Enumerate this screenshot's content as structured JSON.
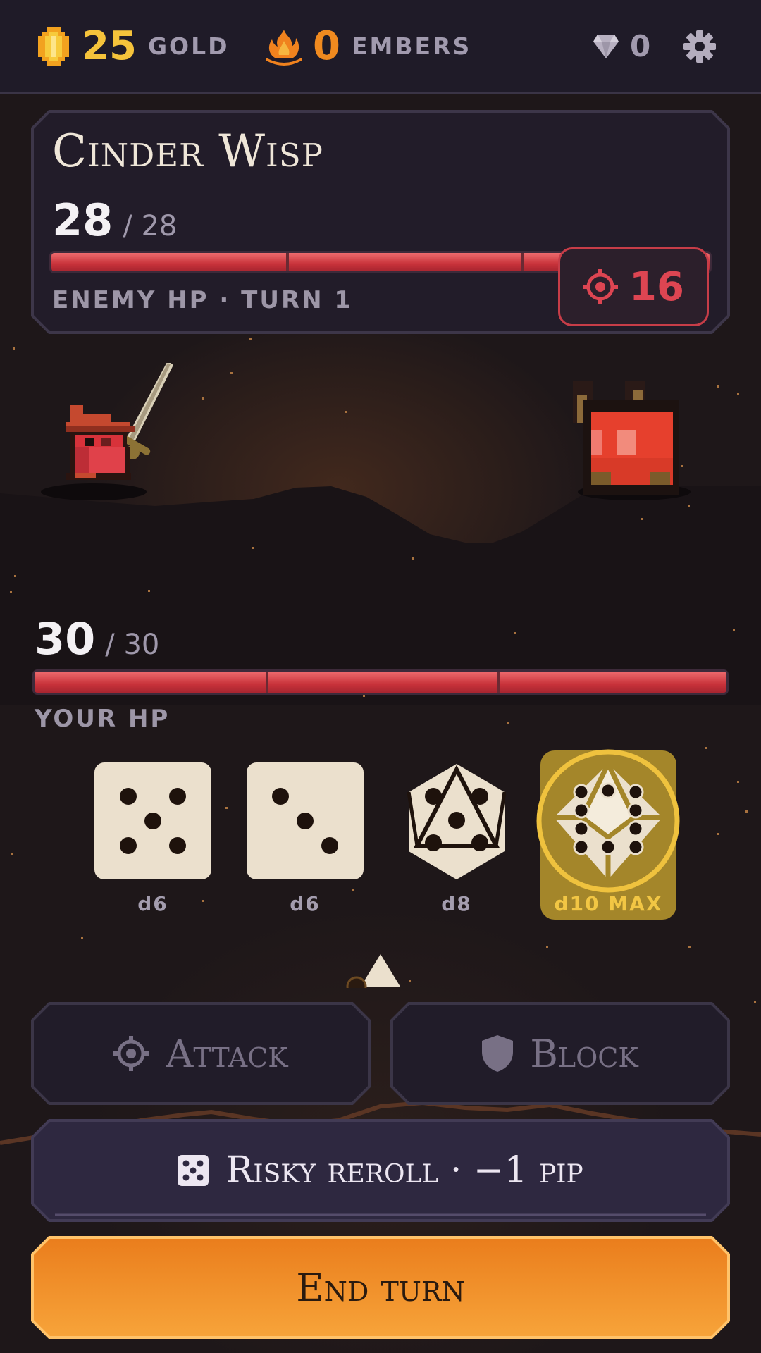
{
  "resources": {
    "gold": {
      "value": "25",
      "label": "GOLD"
    },
    "embers": {
      "value": "0",
      "label": "EMBERS"
    },
    "gems": {
      "value": "0"
    }
  },
  "enemy": {
    "name": "Cinder Wisp",
    "hp": "28",
    "hp_max": "/ 28",
    "hp_fraction": 1.0,
    "caption": "ENEMY HP · TURN 1",
    "intent_value": "16"
  },
  "player": {
    "hp": "30",
    "hp_max": "/ 30",
    "hp_fraction": 1.0,
    "caption": "YOUR HP"
  },
  "dice": [
    {
      "type": "d6",
      "label": "d6",
      "face": 5
    },
    {
      "type": "d6",
      "label": "d6",
      "face": 3
    },
    {
      "type": "d8",
      "label": "d8",
      "face": 5
    },
    {
      "type": "d10",
      "label": "d10 MAX",
      "face": 10,
      "max": true
    }
  ],
  "actions": {
    "attack": "Attack",
    "block": "Block",
    "reroll": "Risky reroll · −1 pip",
    "end_turn": "End turn"
  },
  "colors": {
    "gold": "#f5c33b",
    "ember": "#f08a1f",
    "hp_red": "#d63b43",
    "intent_red": "#dd4552",
    "end_turn_orange": "#f08a22"
  },
  "icons": [
    "gold-coin-icon",
    "ember-flame-icon",
    "gem-icon",
    "gear-icon",
    "crosshair-icon",
    "shield-icon",
    "dice-icon"
  ]
}
